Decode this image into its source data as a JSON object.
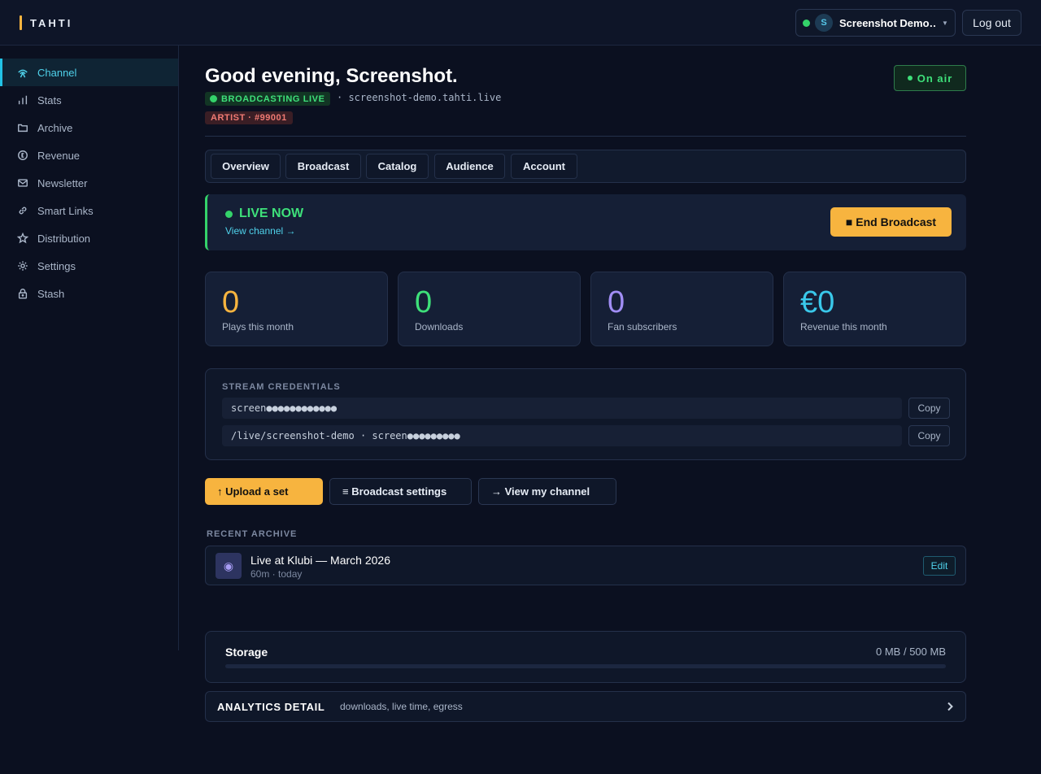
{
  "app": {
    "brand": "TAHTI"
  },
  "topbar": {
    "user_initial": "S",
    "user_name": "Screenshot Demo…",
    "logout_label": "Log out"
  },
  "sidebar": {
    "items": [
      {
        "label": "Channel",
        "icon": "broadcast-icon",
        "active": true
      },
      {
        "label": "Stats",
        "icon": "bar-chart-icon",
        "active": false
      },
      {
        "label": "Archive",
        "icon": "folder-icon",
        "active": false
      },
      {
        "label": "Revenue",
        "icon": "coin-icon",
        "active": false
      },
      {
        "label": "Newsletter",
        "icon": "mail-icon",
        "active": false
      },
      {
        "label": "Smart Links",
        "icon": "link-icon",
        "active": false
      },
      {
        "label": "Distribution",
        "icon": "star-icon",
        "active": false
      },
      {
        "label": "Settings",
        "icon": "gear-icon",
        "active": false
      },
      {
        "label": "Stash",
        "icon": "lock-icon",
        "active": false
      }
    ]
  },
  "header": {
    "greeting": "Good evening, Screenshot.",
    "live_badge": "BROADCASTING LIVE",
    "domain": "· screenshot-demo.tahti.live",
    "artist_badge": "ARTIST · #99001",
    "on_air_label": "On air"
  },
  "tabs": [
    "Overview",
    "Broadcast",
    "Catalog",
    "Audience",
    "Account"
  ],
  "live_card": {
    "title": "LIVE NOW",
    "link": "View channel →",
    "end_button": "■ End Broadcast"
  },
  "stats": [
    {
      "value": "0",
      "label": "Plays this month",
      "color": "#f7b43f"
    },
    {
      "value": "0",
      "label": "Downloads",
      "color": "#3ee07a"
    },
    {
      "value": "0",
      "label": "Fan subscribers",
      "color": "#a18ef5"
    },
    {
      "value": "€0",
      "label": "Revenue this month",
      "color": "#3ac8ea"
    }
  ],
  "credentials": {
    "title": "STREAM CREDENTIALS",
    "rows": [
      {
        "value": "screen●●●●●●●●●●●●",
        "copy": "Copy"
      },
      {
        "value": "/live/screenshot-demo · screen●●●●●●●●●",
        "copy": "Copy"
      }
    ]
  },
  "actions": {
    "upload": "↑ Upload a set",
    "settings": "≡ Broadcast settings",
    "view": "→ View my channel"
  },
  "archive": {
    "section_label": "RECENT ARCHIVE",
    "items": [
      {
        "title": "Live at Klubi — March 2026",
        "meta": "60m · today",
        "edit": "Edit",
        "icon": "record-icon"
      }
    ]
  },
  "storage": {
    "label": "Storage",
    "value": "0 MB / 500 MB",
    "used_fraction": 0
  },
  "analytics": {
    "title": "ANALYTICS DETAIL",
    "subtitle": "downloads, live time, egress"
  },
  "colors": {
    "accent": "#f7b43f",
    "live": "#34d36a",
    "link": "#4fd1ea",
    "danger": "#f07a73"
  }
}
